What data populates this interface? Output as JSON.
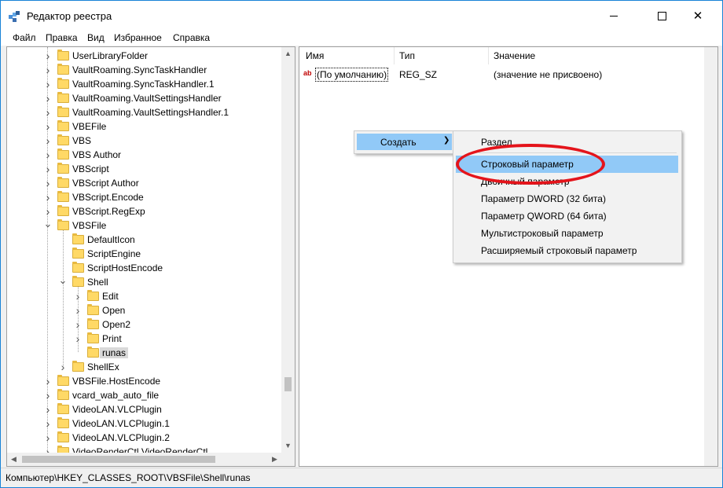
{
  "window": {
    "title": "Редактор реестра"
  },
  "menu": [
    "Файл",
    "Правка",
    "Вид",
    "Избранное",
    "Справка"
  ],
  "tree": [
    {
      "label": "UserLibraryFolder",
      "level": 0,
      "expander": "closed"
    },
    {
      "label": "VaultRoaming.SyncTaskHandler",
      "level": 0,
      "expander": "closed"
    },
    {
      "label": "VaultRoaming.SyncTaskHandler.1",
      "level": 0,
      "expander": "closed"
    },
    {
      "label": "VaultRoaming.VaultSettingsHandler",
      "level": 0,
      "expander": "closed"
    },
    {
      "label": "VaultRoaming.VaultSettingsHandler.1",
      "level": 0,
      "expander": "closed"
    },
    {
      "label": "VBEFile",
      "level": 0,
      "expander": "closed"
    },
    {
      "label": "VBS",
      "level": 0,
      "expander": "closed"
    },
    {
      "label": "VBS Author",
      "level": 0,
      "expander": "closed"
    },
    {
      "label": "VBScript",
      "level": 0,
      "expander": "closed"
    },
    {
      "label": "VBScript Author",
      "level": 0,
      "expander": "closed"
    },
    {
      "label": "VBScript.Encode",
      "level": 0,
      "expander": "closed"
    },
    {
      "label": "VBScript.RegExp",
      "level": 0,
      "expander": "closed"
    },
    {
      "label": "VBSFile",
      "level": 0,
      "expander": "open"
    },
    {
      "label": "DefaultIcon",
      "level": 1,
      "expander": "none"
    },
    {
      "label": "ScriptEngine",
      "level": 1,
      "expander": "none"
    },
    {
      "label": "ScriptHostEncode",
      "level": 1,
      "expander": "none"
    },
    {
      "label": "Shell",
      "level": 1,
      "expander": "open"
    },
    {
      "label": "Edit",
      "level": 2,
      "expander": "closed"
    },
    {
      "label": "Open",
      "level": 2,
      "expander": "closed"
    },
    {
      "label": "Open2",
      "level": 2,
      "expander": "closed"
    },
    {
      "label": "Print",
      "level": 2,
      "expander": "closed"
    },
    {
      "label": "runas",
      "level": 2,
      "expander": "none",
      "selected": true
    },
    {
      "label": "ShellEx",
      "level": 1,
      "expander": "closed"
    },
    {
      "label": "VBSFile.HostEncode",
      "level": 0,
      "expander": "closed"
    },
    {
      "label": "vcard_wab_auto_file",
      "level": 0,
      "expander": "closed"
    },
    {
      "label": "VideoLAN.VLCPlugin",
      "level": 0,
      "expander": "closed"
    },
    {
      "label": "VideoLAN.VLCPlugin.1",
      "level": 0,
      "expander": "closed"
    },
    {
      "label": "VideoLAN.VLCPlugin.2",
      "level": 0,
      "expander": "closed"
    },
    {
      "label": "VideoRenderCtl.VideoRenderCtl",
      "level": 0,
      "expander": "closed"
    }
  ],
  "list": {
    "columns": [
      "Имя",
      "Тип",
      "Значение"
    ],
    "rows": [
      {
        "name": "(По умолчанию)",
        "type": "REG_SZ",
        "value": "(значение не присвоено)",
        "icon": "string-value-icon"
      }
    ]
  },
  "context_menu": {
    "create_label": "Создать",
    "submenu": [
      "Раздел",
      "Строковый параметр",
      "Двоичный параметр",
      "Параметр DWORD (32 бита)",
      "Параметр QWORD (64 бита)",
      "Мультистроковый параметр",
      "Расширяемый строковый параметр"
    ],
    "highlighted_index": 1
  },
  "status_path": "Компьютер\\HKEY_CLASSES_ROOT\\VBSFile\\Shell\\runas",
  "colors": {
    "accent": "#1883d7",
    "menu_highlight": "#91c9f7",
    "annotation": "#e4141b"
  }
}
